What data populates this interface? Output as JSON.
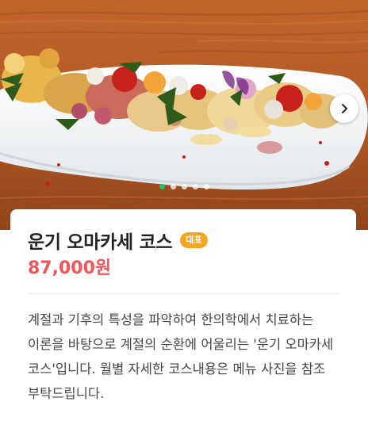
{
  "hero": {
    "image_alt": "",
    "slides": 5,
    "active_slide": 1,
    "next_icon": "chevron-right-icon",
    "colors": {
      "active_dot": "#1ec363",
      "inactive_dot": "#ffffff"
    }
  },
  "menu": {
    "title": "운기 오마카세 코스",
    "badge": "대표",
    "price": "87,000원",
    "description": "계절과 기후의 특성을 파악하여 한의학에서 치료하는 이론을 바탕으로 계절의 순환에 어울리는 '운기 오마카세 코스'입니다. 월별 자세한 코스내용은 메뉴 사진을 참조 부탁드립니다.",
    "colors": {
      "badge": "#f5a623",
      "price": "#f2555a"
    }
  }
}
